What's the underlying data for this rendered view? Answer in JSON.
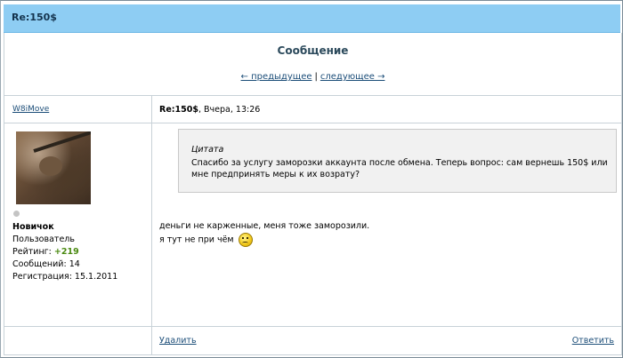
{
  "window": {
    "title": "Re:150$"
  },
  "page": {
    "heading": "Сообщение",
    "nav": {
      "prev": "← предыдущее",
      "separator": "|",
      "next": "следующее →"
    }
  },
  "post": {
    "author": "W8iMove",
    "subject": "Re:150$",
    "date": ", Вчера, 13:26",
    "quote": {
      "title": "Цитата",
      "text": "Спасибо за услугу заморозки аккаунта после обмена. Теперь вопрос: сам вернешь 150$ или мне предпринять меры к их возрату?"
    },
    "message": {
      "line1": "деньги не карженные, меня тоже заморозили.",
      "line2": "я тут не при чём"
    },
    "actions": {
      "delete": "Удалить",
      "reply": "Ответить"
    }
  },
  "user": {
    "rank": "Новичок",
    "group": "Пользователь",
    "rating_label": "Рейтинг: ",
    "rating_value": "+219",
    "posts": "Сообщений: 14",
    "registered": "Регистрация: 15.1.2011"
  },
  "icons": {
    "status": "offline-dot-icon",
    "smiley": "unhappy-smiley-icon"
  }
}
